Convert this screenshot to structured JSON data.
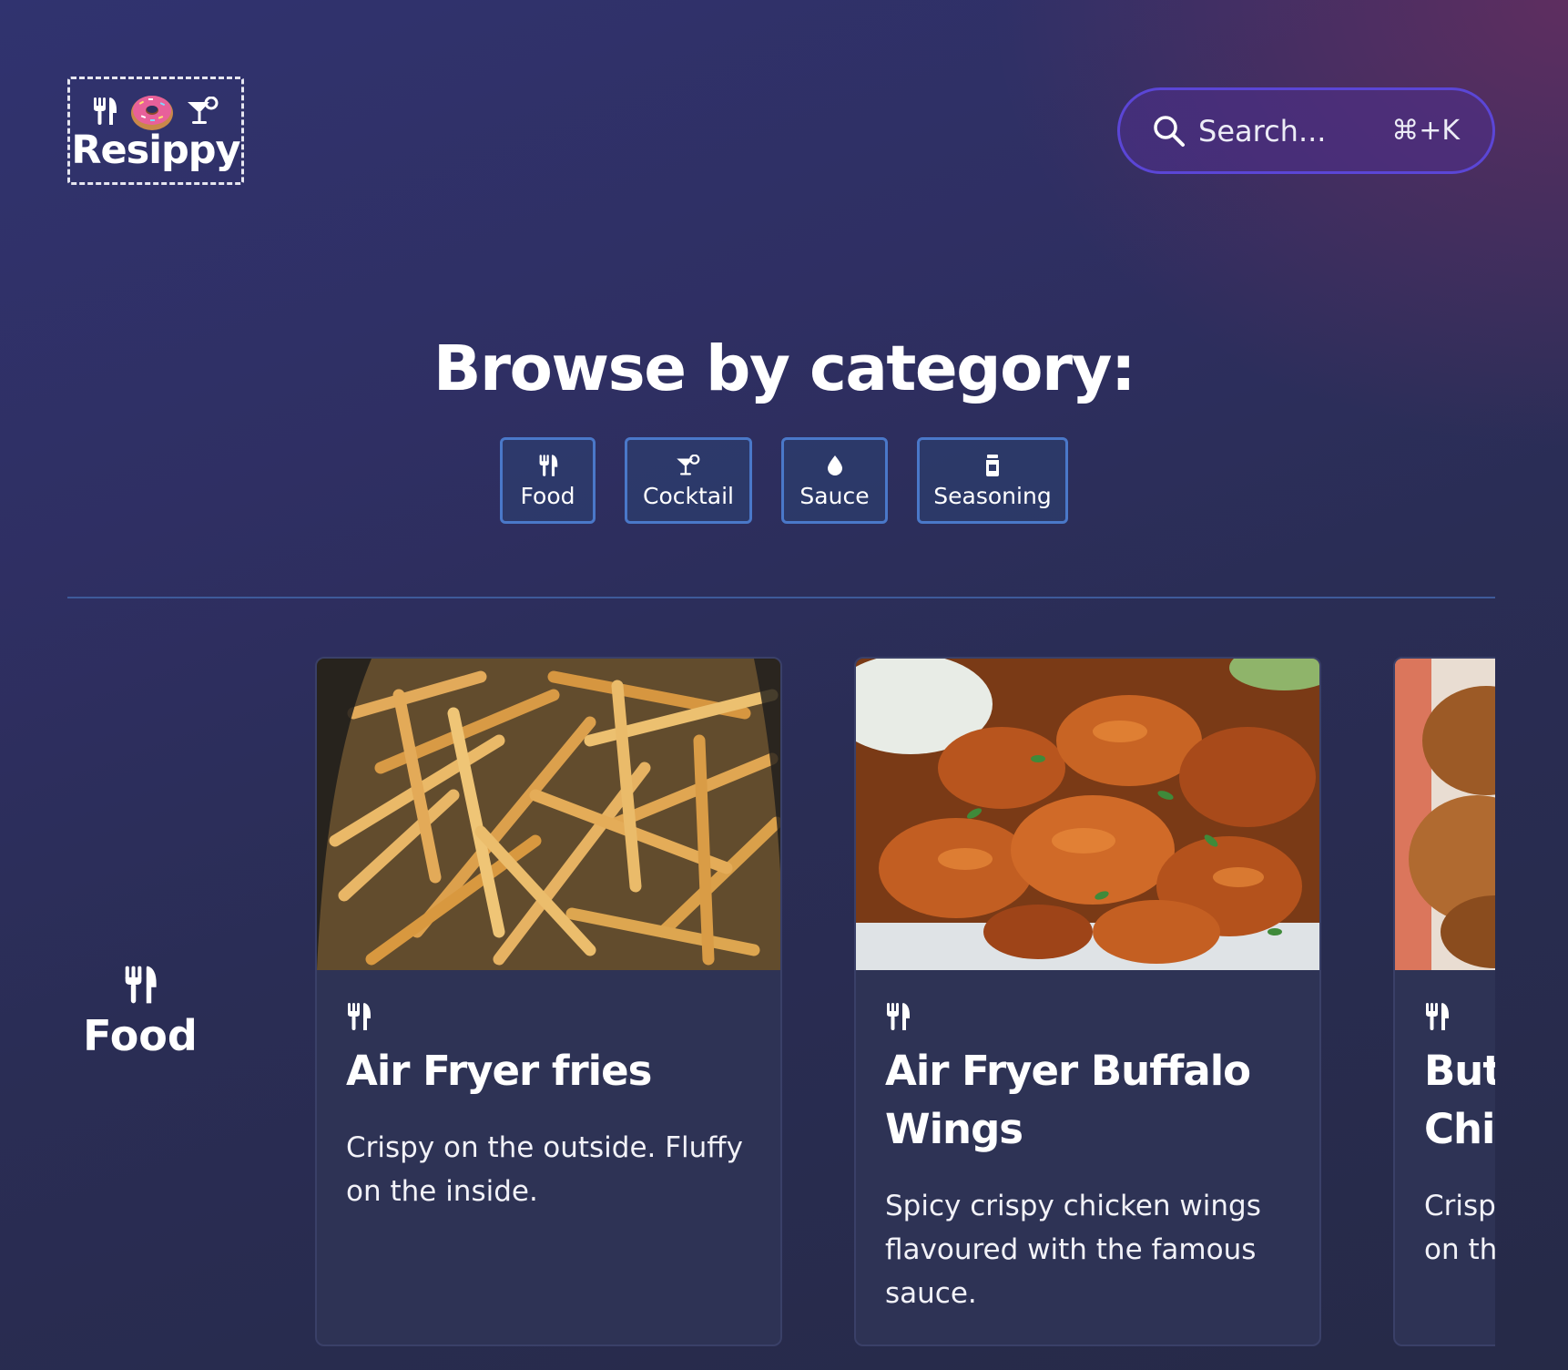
{
  "app": {
    "name": "Resippy"
  },
  "search": {
    "placeholder": "Search...",
    "shortcut": "⌘+K"
  },
  "browse": {
    "title": "Browse by category:",
    "categories": [
      {
        "label": "Food",
        "icon": "utensils-icon"
      },
      {
        "label": "Cocktail",
        "icon": "cocktail-icon"
      },
      {
        "label": "Sauce",
        "icon": "droplet-icon"
      },
      {
        "label": "Seasoning",
        "icon": "jar-icon"
      }
    ]
  },
  "section": {
    "label": "Food",
    "icon": "utensils-icon"
  },
  "recipes": [
    {
      "title": "Air Fryer fries",
      "description": "Crispy on the outside. Fluffy on the inside.",
      "icon": "utensils-icon",
      "image": "fries-photo"
    },
    {
      "title": "Air Fryer Buffalo Wings",
      "description": "Spicy crispy chicken wings flavoured with the famous sauce.",
      "icon": "utensils-icon",
      "image": "wings-photo"
    },
    {
      "title": "Buttermilk Fried Chicken",
      "description": "Crispy on the outside, juicy on the inside.",
      "icon": "utensils-icon",
      "image": "fried-chicken-photo"
    }
  ],
  "colors": {
    "accent": "#5b46d6",
    "category_border": "#4a78c9",
    "card_bg": "#2e3355"
  }
}
